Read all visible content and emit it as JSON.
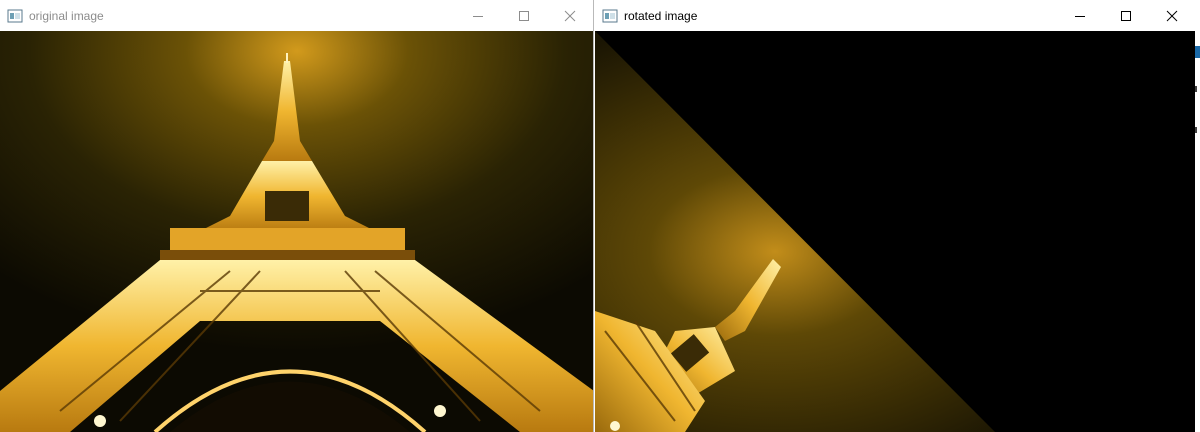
{
  "windows": [
    {
      "title": "original image",
      "active": false,
      "controls": [
        "minimize",
        "maximize",
        "close"
      ],
      "content": "Eiffel Tower photographed from below at night, lit with golden lights"
    },
    {
      "title": "rotated image",
      "active": true,
      "controls": [
        "minimize",
        "maximize",
        "close"
      ],
      "content": "Same photo rotated 45 degrees, black fill in the upper-right triangle"
    }
  ],
  "icons": {
    "app": "opencv-window-icon",
    "minimize": "minimize-icon",
    "maximize": "maximize-icon",
    "close": "close-icon"
  },
  "colors": {
    "titlebar_bg": "#ffffff",
    "inactive_title": "#8c8c8c",
    "active_title": "#000000",
    "tower_gold": "#f5c542",
    "sky_haze": "#6b5206",
    "background_black": "#000000"
  }
}
